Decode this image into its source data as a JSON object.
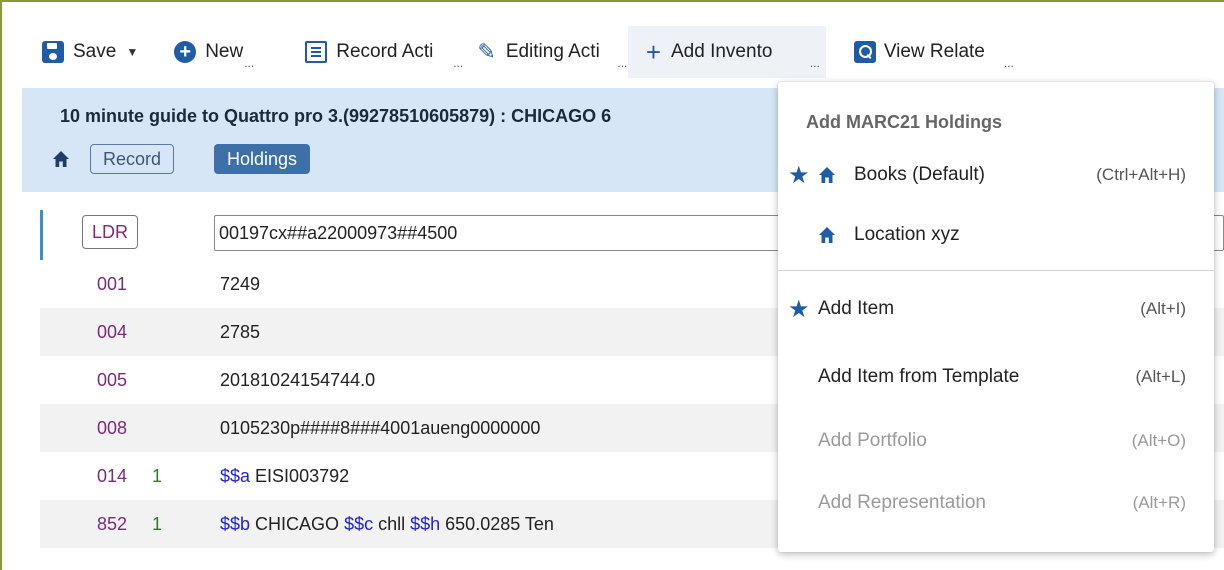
{
  "toolbar": {
    "save_label": "Save",
    "new_label": "New",
    "record_actions_label": "Record Acti",
    "editing_actions_label": "Editing Acti",
    "add_inventory_label": "Add Invento",
    "view_related_label": "View Relate",
    "ellipsis": "..."
  },
  "header": {
    "record_title": "10 minute guide to Quattro pro 3.(99278510605879) : CHICAGO 6",
    "tabs": {
      "record": "Record",
      "holdings": "Holdings"
    }
  },
  "editor": {
    "ldr": {
      "tag": "LDR",
      "value": "00197cx##a22000973##4500"
    },
    "rows": [
      {
        "tag": "001",
        "ind": "",
        "value": "7249"
      },
      {
        "tag": "004",
        "ind": "",
        "value": "2785"
      },
      {
        "tag": "005",
        "ind": "",
        "value": "20181024154744.0"
      },
      {
        "tag": "008",
        "ind": "",
        "value": "0105230p####8###4001aueng0000000"
      },
      {
        "tag": "014",
        "ind": "1",
        "sub_a_code": "$$a",
        "sub_a": " EISI003792"
      },
      {
        "tag": "852",
        "ind": "1",
        "sub_b_code": "$$b",
        "sub_b": " CHICAGO ",
        "sub_c_code": "$$c",
        "sub_c": " chll ",
        "sub_h_code": "$$h",
        "sub_h": " 650.0285 Ten"
      }
    ]
  },
  "menu": {
    "heading": "Add MARC21 Holdings",
    "items": [
      {
        "label": "Books (Default)",
        "shortcut": "(Ctrl+Alt+H)",
        "starred": true,
        "enabled": true
      },
      {
        "label": "Location xyz",
        "shortcut": "",
        "starred": false,
        "enabled": true
      },
      {
        "label": "Add Item",
        "shortcut": "(Alt+I)",
        "starred": true,
        "enabled": true
      },
      {
        "label": "Add Item from Template",
        "shortcut": "(Alt+L)",
        "starred": false,
        "enabled": true
      },
      {
        "label": "Add Portfolio",
        "shortcut": "(Alt+O)",
        "starred": false,
        "enabled": false
      },
      {
        "label": "Add Representation",
        "shortcut": "(Alt+R)",
        "starred": false,
        "enabled": false
      }
    ]
  },
  "colors": {
    "accent": "#1f5ca8",
    "header_band": "#d7e6f7",
    "tag_color": "#7b2a7b",
    "indicator_color": "#2d7a2d",
    "subfield_color": "#2222cc"
  }
}
